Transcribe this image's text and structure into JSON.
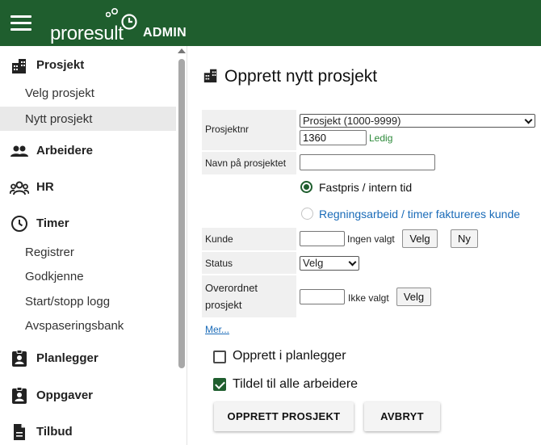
{
  "header": {
    "logo_text": "proresult",
    "logo_badge": "ADMIN"
  },
  "sidebar": {
    "groups": [
      {
        "label": "Prosjekt",
        "icon": "buildings-icon"
      },
      {
        "label": "Arbeidere",
        "icon": "people-icon"
      },
      {
        "label": "HR",
        "icon": "group-icon"
      },
      {
        "label": "Timer",
        "icon": "clock-icon"
      },
      {
        "label": "Planlegger",
        "icon": "badge-person-icon"
      },
      {
        "label": "Oppgaver",
        "icon": "badge-person-icon"
      },
      {
        "label": "Tilbud",
        "icon": "document-icon"
      }
    ],
    "subitems": {
      "prosjekt": [
        "Velg prosjekt",
        "Nytt prosjekt"
      ],
      "timer": [
        "Registrer",
        "Godkjenne",
        "Start/stopp logg",
        "Avspaseringsbank"
      ]
    },
    "active_item": "Nytt prosjekt"
  },
  "page": {
    "title": "Opprett nytt prosjekt"
  },
  "form": {
    "prosjektnr": {
      "label": "Prosjektnr",
      "select_value": "Prosjekt (1000-9999)",
      "number_value": "1360",
      "availability": "Ledig"
    },
    "navn": {
      "label": "Navn på prosjektet",
      "value": ""
    },
    "pricing": {
      "option_fixed": "Fastpris / intern tid",
      "option_hourly": "Regningsarbeid / timer faktureres kunde",
      "selected": "fixed"
    },
    "kunde": {
      "label": "Kunde",
      "value": "",
      "status": "Ingen valgt",
      "select_button": "Velg",
      "new_button": "Ny"
    },
    "status": {
      "label": "Status",
      "select_value": "Velg"
    },
    "overordnet": {
      "label_line1": "Overordnet",
      "label_line2": "prosjekt",
      "value": "",
      "status": "Ikke valgt",
      "select_button": "Velg"
    },
    "more_link": "Mer...",
    "checkbox_planner": {
      "label": "Opprett i planlegger",
      "checked": false
    },
    "checkbox_assign": {
      "label": "Tildel til alle arbeidere",
      "checked": true
    }
  },
  "actions": {
    "create": "OPPRETT PROSJEKT",
    "cancel": "AVBRYT"
  },
  "colors": {
    "brand": "#1f5e2e",
    "success": "#2d8a3a",
    "link": "#1a6bb8",
    "radio_inactive_text": "#1a6bb8"
  }
}
